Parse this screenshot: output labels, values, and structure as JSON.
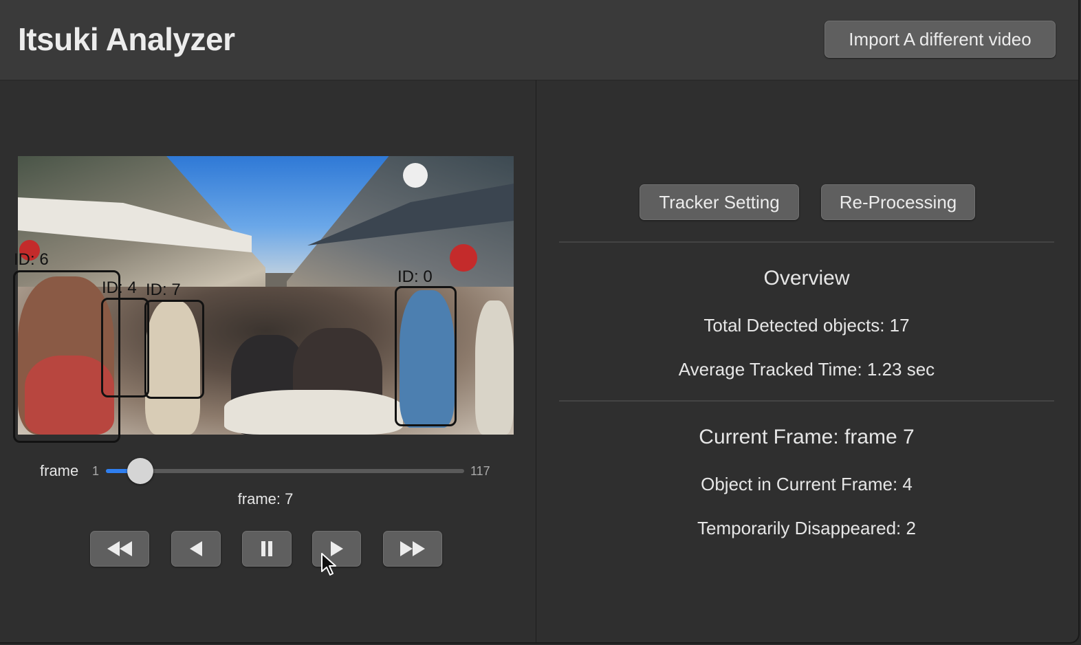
{
  "header": {
    "title": "Itsuki Analyzer",
    "import_button": "Import A different video"
  },
  "video": {
    "detections": [
      {
        "label": "ID: 6"
      },
      {
        "label": "ID: 4"
      },
      {
        "label": "ID: 7"
      },
      {
        "label": "ID: 0"
      }
    ]
  },
  "slider": {
    "label": "frame",
    "min": "1",
    "max": "117",
    "value": 7,
    "readout": "frame: 7"
  },
  "controls": {
    "icons": [
      "rewind-icon",
      "step-back-icon",
      "pause-icon",
      "play-icon",
      "fast-forward-icon"
    ]
  },
  "right_panel": {
    "tracker_button": "Tracker Setting",
    "reprocess_button": "Re-Processing",
    "overview_title": "Overview",
    "total_detected": "Total Detected objects: 17",
    "avg_tracked_time": "Average Tracked Time: 1.23 sec",
    "current_frame": "Current Frame: frame 7",
    "objects_in_frame": "Object in Current Frame: 4",
    "temporarily_disappeared": "Temporarily Disappeared: 2"
  },
  "colors": {
    "accent": "#2f7ff0",
    "button": "#5f5f5f",
    "background": "#2f2f2f",
    "bbox": "#121212"
  }
}
